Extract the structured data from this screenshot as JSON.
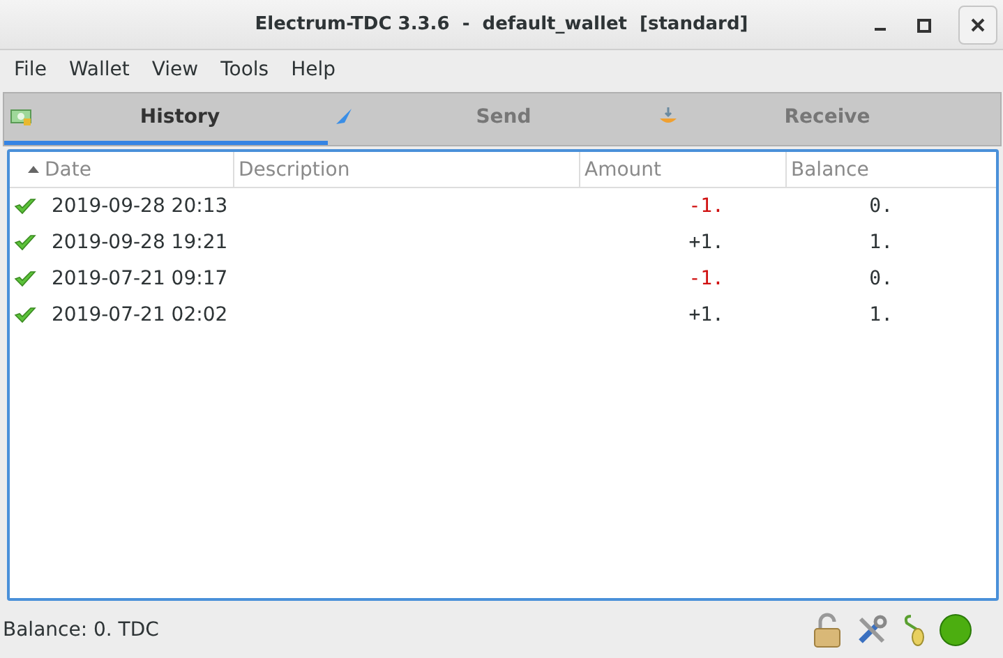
{
  "window": {
    "title": "Electrum-TDC 3.3.6  -  default_wallet  [standard]"
  },
  "menu": [
    "File",
    "Wallet",
    "View",
    "Tools",
    "Help"
  ],
  "tabs": [
    {
      "label": "History",
      "selected": true,
      "kind": "history"
    },
    {
      "label": "Send",
      "selected": false,
      "kind": "send"
    },
    {
      "label": "Receive",
      "selected": false,
      "kind": "receive"
    }
  ],
  "table": {
    "columns": [
      {
        "label": "Date",
        "sorted": true
      },
      {
        "label": "Description",
        "sorted": false
      },
      {
        "label": "Amount",
        "sorted": false
      },
      {
        "label": "Balance",
        "sorted": false
      }
    ],
    "rows": [
      {
        "confirmed": true,
        "date": "2019-09-28 20:13",
        "amount": "-1.",
        "kind": "debit",
        "balance": "0."
      },
      {
        "confirmed": true,
        "date": "2019-09-28 19:21",
        "amount": "+1.",
        "kind": "credit",
        "balance": "1."
      },
      {
        "confirmed": true,
        "date": "2019-07-21 09:17",
        "amount": "-1.",
        "kind": "debit",
        "balance": "0."
      },
      {
        "confirmed": true,
        "date": "2019-07-21 02:02",
        "amount": "+1.",
        "kind": "credit",
        "balance": "1."
      }
    ]
  },
  "status_bar": {
    "balance": "Balance: 0. TDC",
    "connected": true
  }
}
